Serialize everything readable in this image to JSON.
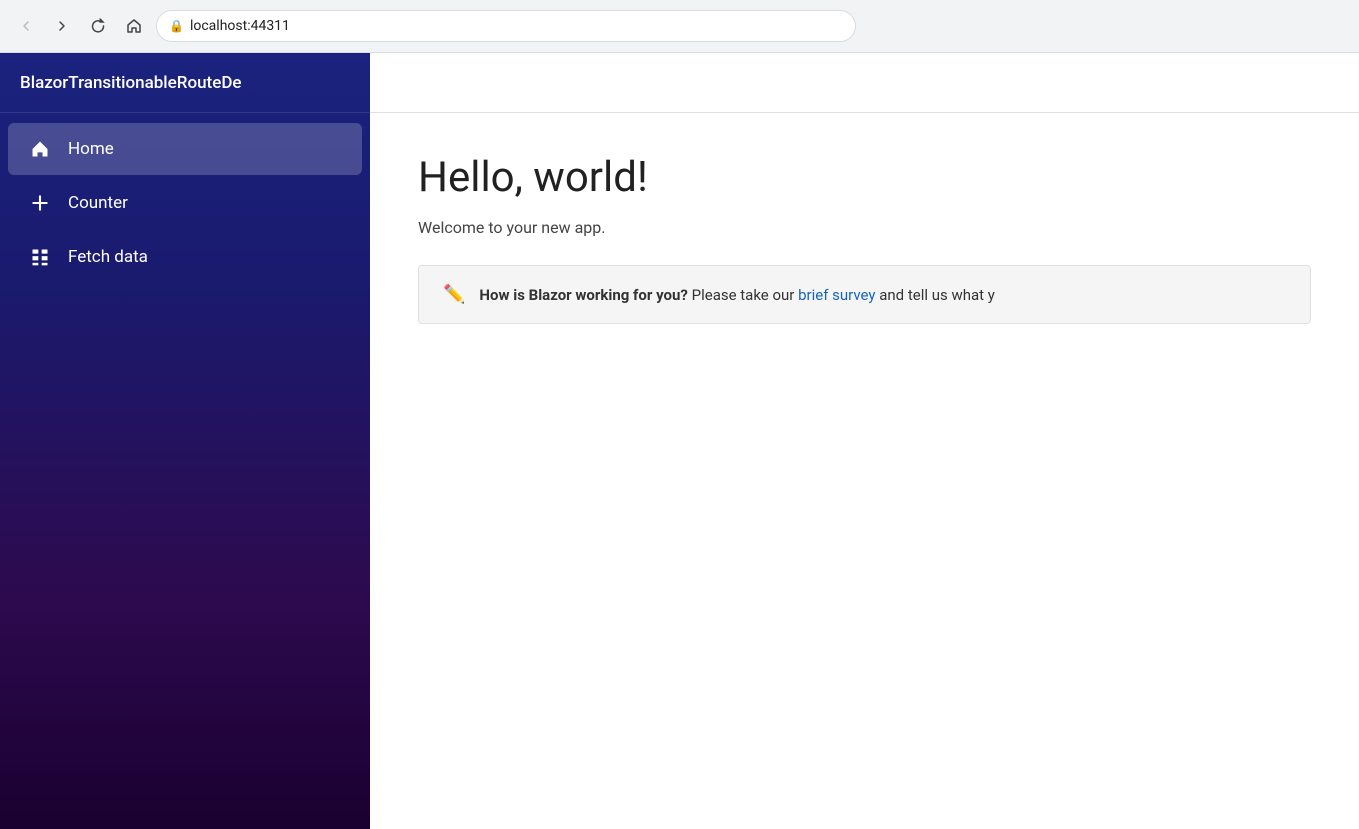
{
  "browser": {
    "url": "localhost:44311",
    "back_disabled": true,
    "forward_disabled": false
  },
  "sidebar": {
    "brand": "BlazorTransitionableRouteDe",
    "items": [
      {
        "id": "home",
        "label": "Home",
        "icon": "home-icon",
        "active": true
      },
      {
        "id": "counter",
        "label": "Counter",
        "icon": "plus-icon",
        "active": false
      },
      {
        "id": "fetch-data",
        "label": "Fetch data",
        "icon": "grid-icon",
        "active": false
      }
    ]
  },
  "main": {
    "title": "Hello, world!",
    "subtitle": "Welcome to your new app.",
    "survey": {
      "bold_text": "How is Blazor working for you?",
      "pre_link_text": " Please take our ",
      "link_text": "brief survey",
      "post_link_text": " and tell us what y"
    }
  }
}
